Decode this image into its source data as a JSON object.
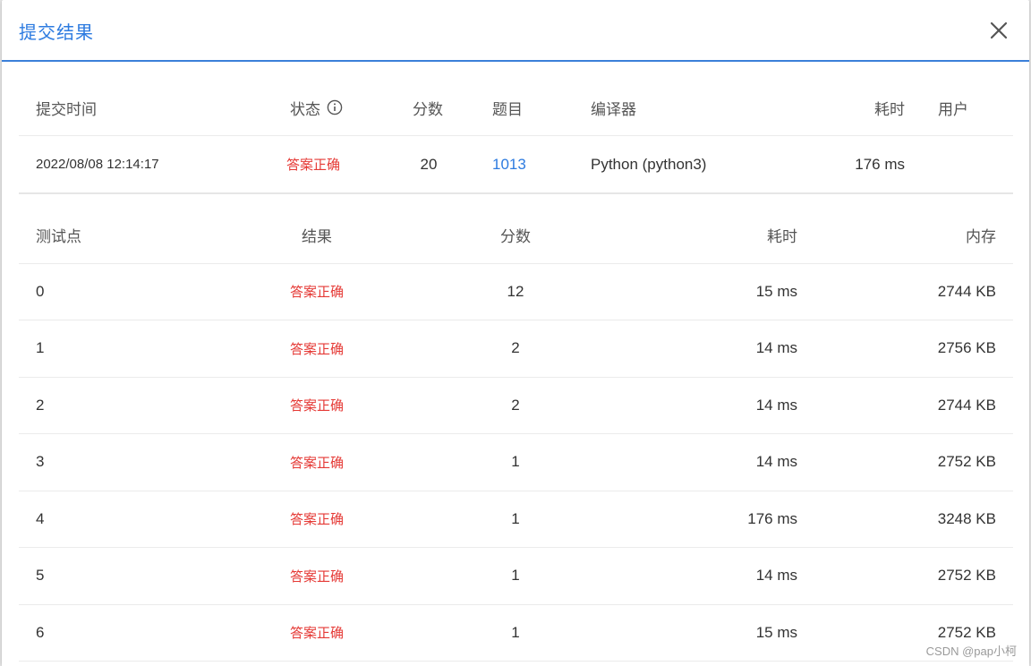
{
  "dialog": {
    "title": "提交结果",
    "close_icon": "close-icon"
  },
  "summary": {
    "headers": {
      "time": "提交时间",
      "status": "状态",
      "score": "分数",
      "problem": "题目",
      "compiler": "编译器",
      "duration": "耗时",
      "user": "用户"
    },
    "row": {
      "time": "2022/08/08 12:14:17",
      "status": "答案正确",
      "score": "20",
      "problem": "1013",
      "compiler": "Python (python3)",
      "duration": "176 ms",
      "user": ""
    }
  },
  "cases": {
    "headers": {
      "case": "测试点",
      "result": "结果",
      "score": "分数",
      "duration": "耗时",
      "memory": "内存"
    },
    "rows": [
      {
        "case": "0",
        "result": "答案正确",
        "score": "12",
        "duration": "15 ms",
        "memory": "2744 KB"
      },
      {
        "case": "1",
        "result": "答案正确",
        "score": "2",
        "duration": "14 ms",
        "memory": "2756 KB"
      },
      {
        "case": "2",
        "result": "答案正确",
        "score": "2",
        "duration": "14 ms",
        "memory": "2744 KB"
      },
      {
        "case": "3",
        "result": "答案正确",
        "score": "1",
        "duration": "14 ms",
        "memory": "2752 KB"
      },
      {
        "case": "4",
        "result": "答案正确",
        "score": "1",
        "duration": "176 ms",
        "memory": "3248 KB"
      },
      {
        "case": "5",
        "result": "答案正确",
        "score": "1",
        "duration": "14 ms",
        "memory": "2752 KB"
      },
      {
        "case": "6",
        "result": "答案正确",
        "score": "1",
        "duration": "15 ms",
        "memory": "2752 KB"
      }
    ]
  },
  "watermark": "CSDN @pap小柯",
  "colors": {
    "accent": "#2d7be0",
    "success_text": "#e53935"
  }
}
